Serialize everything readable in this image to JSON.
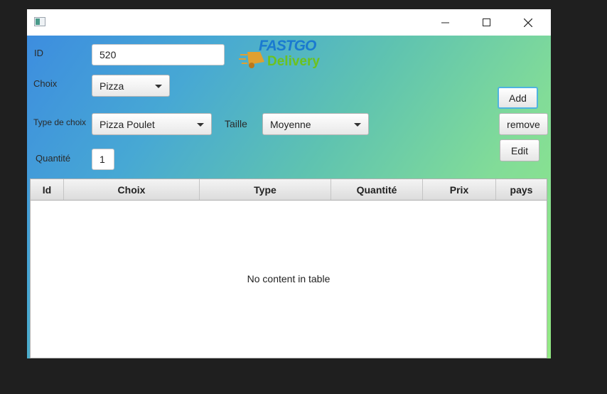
{
  "window": {
    "title": ""
  },
  "form": {
    "id_label": "ID",
    "id_value": "520",
    "choix_label": "Choix",
    "choix_value": "Pizza",
    "type_label": "Type de choix",
    "type_value": "Pizza Poulet",
    "taille_label": "Taille",
    "taille_value": "Moyenne",
    "quantite_label": "Quantité",
    "quantite_value": "1"
  },
  "logo": {
    "line1": "FASTGO",
    "line2": "Delivery"
  },
  "buttons": {
    "add": "Add",
    "remove": "remove",
    "edit": "Edit"
  },
  "table": {
    "columns": [
      "Id",
      "Choix",
      "Type",
      "Quantité",
      "Prix",
      "pays"
    ],
    "rows": [],
    "placeholder": "No content in table"
  },
  "colors": {
    "accent": "#4fb3e0",
    "logo_blue": "#1a7ad0",
    "logo_green": "#6cc21e"
  }
}
